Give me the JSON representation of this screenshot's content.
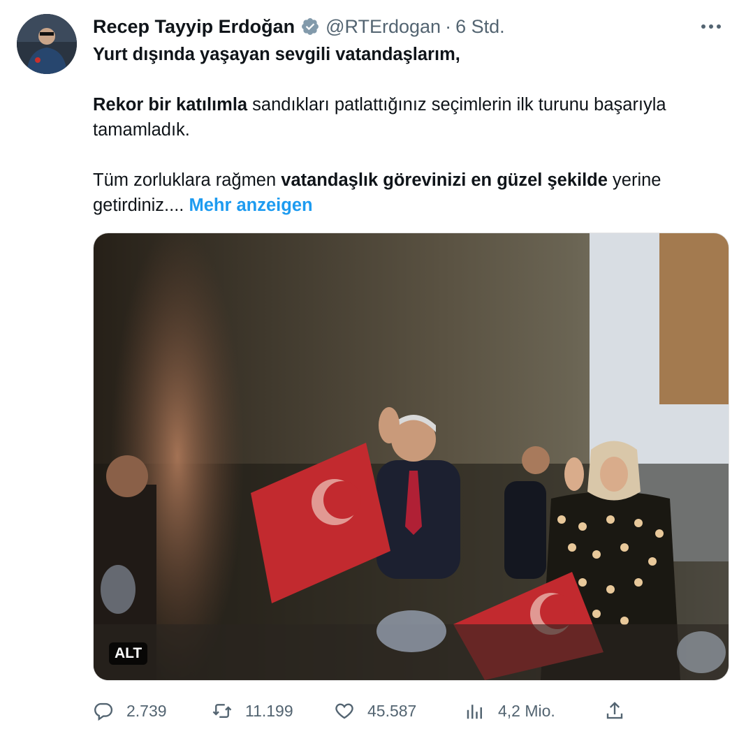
{
  "tweet": {
    "author_name": "Recep Tayyip Erdoğan",
    "handle": "@RTErdogan",
    "separator": "·",
    "time": "6 Std.",
    "more_label": "···",
    "paragraph1_bold": "Yurt dışında yaşayan sevgili vatandaşlarım,",
    "paragraph2_bold": "Rekor bir katılımla",
    "paragraph2_text": " sandıkları patlattığınız seçimlerin ilk turunu başarıyla tamamladık.",
    "paragraph3_text_a": "Tüm zorluklara rağmen ",
    "paragraph3_bold": "vatandaşlık görevinizi en güzel şekilde",
    "paragraph3_text_b": " yerine getirdiniz.... ",
    "show_more": "Mehr anzeigen",
    "alt_badge": "ALT"
  },
  "actions": {
    "replies": "2.739",
    "retweets": "11.199",
    "likes": "45.587",
    "views": "4,2 Mio."
  },
  "icons": [
    "verified-badge-icon",
    "more-icon",
    "reply-icon",
    "retweet-icon",
    "like-icon",
    "views-icon",
    "share-icon"
  ],
  "colors": {
    "text": "#0f1419",
    "secondary": "#536471",
    "link": "#1d9bf0",
    "verified": "#829aab"
  }
}
